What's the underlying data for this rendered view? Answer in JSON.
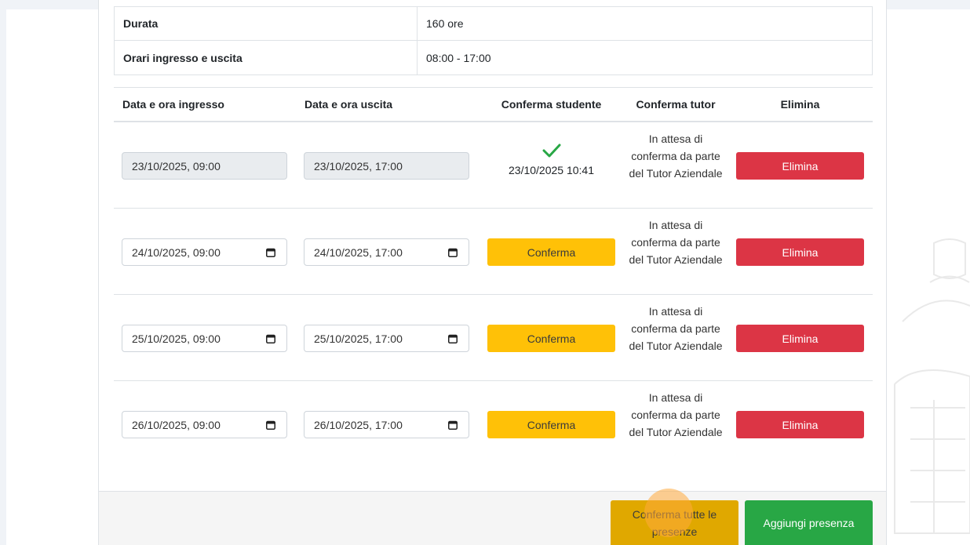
{
  "info": {
    "rows": [
      {
        "label": "Durata",
        "value": "160 ore"
      },
      {
        "label": "Orari ingresso e uscita",
        "value": "08:00 - 17:00"
      }
    ]
  },
  "table": {
    "headers": {
      "entry": "Data e ora ingresso",
      "exit": "Data e ora uscita",
      "student_confirm": "Conferma studente",
      "tutor_confirm": "Conferma tutor",
      "delete": "Elimina"
    },
    "rows": [
      {
        "entry": "23/10/2025, 09:00",
        "exit": "23/10/2025, 17:00",
        "student_confirmed_at": "23/10/2025 10:41",
        "tutor_status": "In attesa di conferma da parte del Tutor Aziendale",
        "delete_label": "Elimina"
      },
      {
        "entry": "24/10/2025, 09:00",
        "exit": "24/10/2025, 17:00",
        "confirm_label": "Conferma",
        "tutor_status": "In attesa di conferma da parte del Tutor Aziendale",
        "delete_label": "Elimina"
      },
      {
        "entry": "25/10/2025, 09:00",
        "exit": "25/10/2025, 17:00",
        "confirm_label": "Conferma",
        "tutor_status": "In attesa di conferma da parte del Tutor Aziendale",
        "delete_label": "Elimina"
      },
      {
        "entry": "26/10/2025, 09:00",
        "exit": "26/10/2025, 17:00",
        "confirm_label": "Conferma",
        "tutor_status": "In attesa di conferma da parte del Tutor Aziendale",
        "delete_label": "Elimina"
      }
    ]
  },
  "footer": {
    "confirm_all_label": "Conferma tutte le presenze",
    "add_label": "Aggiungi presenza"
  },
  "colors": {
    "warning": "#ffc107",
    "danger": "#dc3545",
    "success": "#28a745"
  },
  "icons": {
    "calendar": "calendar-icon",
    "check": "check-icon"
  }
}
